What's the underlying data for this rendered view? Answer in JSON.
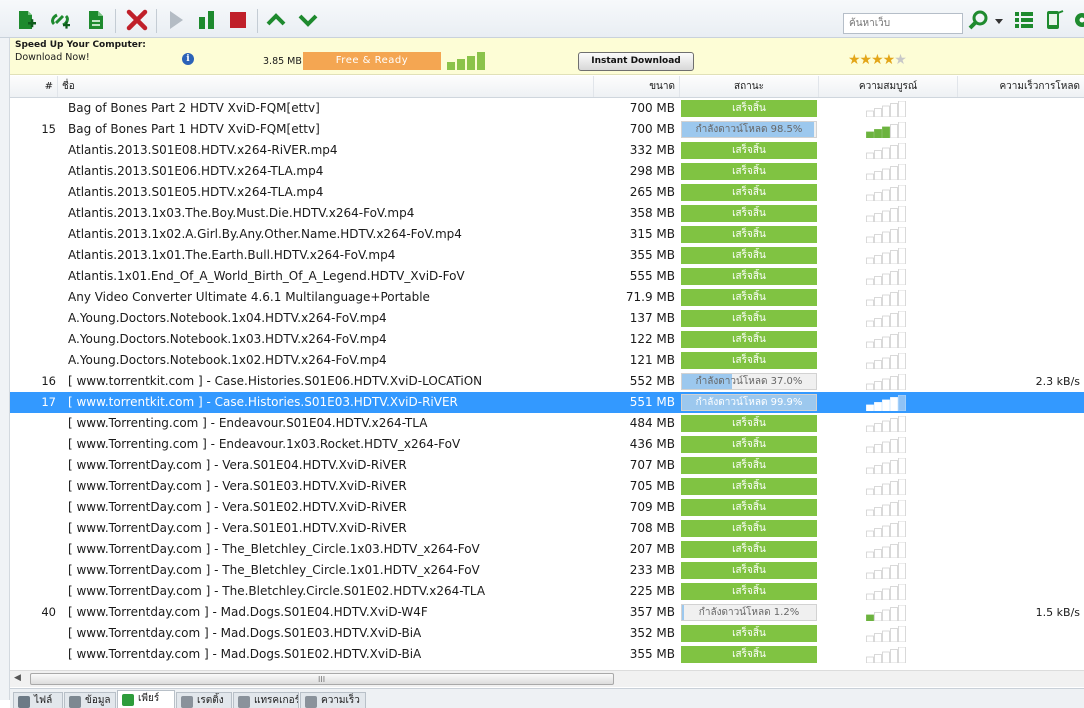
{
  "toolbar": {
    "search_placeholder": "ค้นหาเว็บ",
    "buttons": [
      "add-torrent",
      "add-torrent-from-url",
      "create-torrent",
      "remove",
      "start",
      "pause",
      "stop",
      "move-up",
      "move-down"
    ],
    "colors": {
      "green": "#1e8a2e",
      "red": "#c0202a",
      "disabled": "#b4bcc4"
    }
  },
  "ad": {
    "title": "Speed Up Your Computer:",
    "subtitle": "Download Now!",
    "size": "3.85 MB",
    "badge": "Free & Ready",
    "button": "Instant Download",
    "rating": {
      "filled": "★★★★",
      "empty": "★"
    }
  },
  "columns": {
    "num": "#",
    "name": "ชื่อ",
    "size": "ขนาด",
    "status": "สถานะ",
    "availability": "ความสมบูรณ์",
    "speed": "ความเร็วการโหลด"
  },
  "rows": [
    {
      "num": "",
      "name": "Bag of Bones Part 2 HDTV XviD-FQM[ettv]",
      "size": "700 MB",
      "status": "เสร็จสิ้น",
      "state": "done",
      "progress": 1.0,
      "avail": 0,
      "speed": ""
    },
    {
      "num": "15",
      "name": "Bag of Bones Part 1 HDTV XviD-FQM[ettv]",
      "size": "700 MB",
      "status": "กำลังดาวน์โหลด 98.5%",
      "state": "downloading",
      "progress": 0.985,
      "avail": 3,
      "speed": ""
    },
    {
      "num": "",
      "name": "Atlantis.2013.S01E08.HDTV.x264-RiVER.mp4",
      "size": "332 MB",
      "status": "เสร็จสิ้น",
      "state": "done",
      "progress": 1.0,
      "avail": 0,
      "speed": ""
    },
    {
      "num": "",
      "name": "Atlantis.2013.S01E06.HDTV.x264-TLA.mp4",
      "size": "298 MB",
      "status": "เสร็จสิ้น",
      "state": "done",
      "progress": 1.0,
      "avail": 0,
      "speed": ""
    },
    {
      "num": "",
      "name": "Atlantis.2013.S01E05.HDTV.x264-TLA.mp4",
      "size": "265 MB",
      "status": "เสร็จสิ้น",
      "state": "done",
      "progress": 1.0,
      "avail": 0,
      "speed": ""
    },
    {
      "num": "",
      "name": "Atlantis.2013.1x03.The.Boy.Must.Die.HDTV.x264-FoV.mp4",
      "size": "358 MB",
      "status": "เสร็จสิ้น",
      "state": "done",
      "progress": 1.0,
      "avail": 0,
      "speed": ""
    },
    {
      "num": "",
      "name": "Atlantis.2013.1x02.A.Girl.By.Any.Other.Name.HDTV.x264-FoV.mp4",
      "size": "315 MB",
      "status": "เสร็จสิ้น",
      "state": "done",
      "progress": 1.0,
      "avail": 0,
      "speed": ""
    },
    {
      "num": "",
      "name": "Atlantis.2013.1x01.The.Earth.Bull.HDTV.x264-FoV.mp4",
      "size": "355 MB",
      "status": "เสร็จสิ้น",
      "state": "done",
      "progress": 1.0,
      "avail": 0,
      "speed": ""
    },
    {
      "num": "",
      "name": "Atlantis.1x01.End_Of_A_World_Birth_Of_A_Legend.HDTV_XviD-FoV",
      "size": "555 MB",
      "status": "เสร็จสิ้น",
      "state": "done",
      "progress": 1.0,
      "avail": 0,
      "speed": ""
    },
    {
      "num": "",
      "name": "Any Video Converter Ultimate 4.6.1 Multilanguage+Portable",
      "size": "71.9 MB",
      "status": "เสร็จสิ้น",
      "state": "done",
      "progress": 1.0,
      "avail": 0,
      "speed": ""
    },
    {
      "num": "",
      "name": "A.Young.Doctors.Notebook.1x04.HDTV.x264-FoV.mp4",
      "size": "137 MB",
      "status": "เสร็จสิ้น",
      "state": "done",
      "progress": 1.0,
      "avail": 0,
      "speed": ""
    },
    {
      "num": "",
      "name": "A.Young.Doctors.Notebook.1x03.HDTV.x264-FoV.mp4",
      "size": "122 MB",
      "status": "เสร็จสิ้น",
      "state": "done",
      "progress": 1.0,
      "avail": 0,
      "speed": ""
    },
    {
      "num": "",
      "name": "A.Young.Doctors.Notebook.1x02.HDTV.x264-FoV.mp4",
      "size": "121 MB",
      "status": "เสร็จสิ้น",
      "state": "done",
      "progress": 1.0,
      "avail": 0,
      "speed": ""
    },
    {
      "num": "16",
      "name": "[ www.torrentkit.com ] - Case.Histories.S01E06.HDTV.XviD-LOCATiON",
      "size": "552 MB",
      "status": "กำลังดาวน์โหลด 37.0%",
      "state": "downloading",
      "progress": 0.37,
      "avail": 0,
      "speed": "2.3 kB/s"
    },
    {
      "num": "17",
      "name": "[ www.torrentkit.com ] - Case.Histories.S01E03.HDTV.XviD-RiVER",
      "size": "551 MB",
      "status": "กำลังดาวน์โหลด 99.9%",
      "state": "downloading",
      "progress": 0.999,
      "avail": 4,
      "speed": "",
      "selected": true
    },
    {
      "num": "",
      "name": "[ www.Torrenting.com ] - Endeavour.S01E04.HDTV.x264-TLA",
      "size": "484 MB",
      "status": "เสร็จสิ้น",
      "state": "done",
      "progress": 1.0,
      "avail": 0,
      "speed": ""
    },
    {
      "num": "",
      "name": "[ www.Torrenting.com ] - Endeavour.1x03.Rocket.HDTV_x264-FoV",
      "size": "436 MB",
      "status": "เสร็จสิ้น",
      "state": "done",
      "progress": 1.0,
      "avail": 0,
      "speed": ""
    },
    {
      "num": "",
      "name": "[ www.TorrentDay.com ] - Vera.S01E04.HDTV.XviD-RiVER",
      "size": "707 MB",
      "status": "เสร็จสิ้น",
      "state": "done",
      "progress": 1.0,
      "avail": 0,
      "speed": ""
    },
    {
      "num": "",
      "name": "[ www.TorrentDay.com ] - Vera.S01E03.HDTV.XviD-RiVER",
      "size": "705 MB",
      "status": "เสร็จสิ้น",
      "state": "done",
      "progress": 1.0,
      "avail": 0,
      "speed": ""
    },
    {
      "num": "",
      "name": "[ www.TorrentDay.com ] - Vera.S01E02.HDTV.XviD-RiVER",
      "size": "709 MB",
      "status": "เสร็จสิ้น",
      "state": "done",
      "progress": 1.0,
      "avail": 0,
      "speed": ""
    },
    {
      "num": "",
      "name": "[ www.TorrentDay.com ] - Vera.S01E01.HDTV.XviD-RiVER",
      "size": "708 MB",
      "status": "เสร็จสิ้น",
      "state": "done",
      "progress": 1.0,
      "avail": 0,
      "speed": ""
    },
    {
      "num": "",
      "name": "[ www.TorrentDay.com ] - The_Bletchley_Circle.1x03.HDTV_x264-FoV",
      "size": "207 MB",
      "status": "เสร็จสิ้น",
      "state": "done",
      "progress": 1.0,
      "avail": 0,
      "speed": ""
    },
    {
      "num": "",
      "name": "[ www.TorrentDay.com ] - The_Bletchley_Circle.1x01.HDTV_x264-FoV",
      "size": "233 MB",
      "status": "เสร็จสิ้น",
      "state": "done",
      "progress": 1.0,
      "avail": 0,
      "speed": ""
    },
    {
      "num": "",
      "name": "[ www.TorrentDay.com ] - The.Bletchley.Circle.S01E02.HDTV.x264-TLA",
      "size": "225 MB",
      "status": "เสร็จสิ้น",
      "state": "done",
      "progress": 1.0,
      "avail": 0,
      "speed": ""
    },
    {
      "num": "40",
      "name": "[ www.Torrentday.com ] - Mad.Dogs.S01E04.HDTV.XviD-W4F",
      "size": "357 MB",
      "status": "กำลังดาวน์โหลด 1.2%",
      "state": "downloading",
      "progress": 0.012,
      "avail": 1,
      "speed": "1.5 kB/s"
    },
    {
      "num": "",
      "name": "[ www.Torrentday.com ] - Mad.Dogs.S01E03.HDTV.XviD-BiA",
      "size": "352 MB",
      "status": "เสร็จสิ้น",
      "state": "done",
      "progress": 1.0,
      "avail": 0,
      "speed": ""
    },
    {
      "num": "",
      "name": "[ www.Torrentday.com ] - Mad.Dogs.S01E02.HDTV.XviD-BiA",
      "size": "355 MB",
      "status": "เสร็จสิ้น",
      "state": "done",
      "progress": 1.0,
      "avail": 0,
      "speed": ""
    }
  ],
  "scrollbar": {
    "grip": "III",
    "left_arrow": "◀"
  },
  "tabs": [
    {
      "label": "ไฟล์",
      "icon": "file-icon",
      "color": "#6d7a86"
    },
    {
      "label": "ข้อมูล",
      "icon": "info-icon",
      "color": "#7d8891"
    },
    {
      "label": "เพียร์",
      "icon": "peers-icon",
      "color": "#2e9c3b",
      "active": true
    },
    {
      "label": "เรตติ้ง",
      "icon": "ratings-icon",
      "color": "#8a929b"
    },
    {
      "label": "แทรคเกอร์",
      "icon": "trackers-icon",
      "color": "#8a929b"
    },
    {
      "label": "ความเร็ว",
      "icon": "speed-icon",
      "color": "#8a929b"
    }
  ],
  "colors": {
    "done": "#80c342",
    "progress": "#9cc8ee",
    "selected_row": "#3399ff",
    "ad_badge": "#f4a652"
  }
}
